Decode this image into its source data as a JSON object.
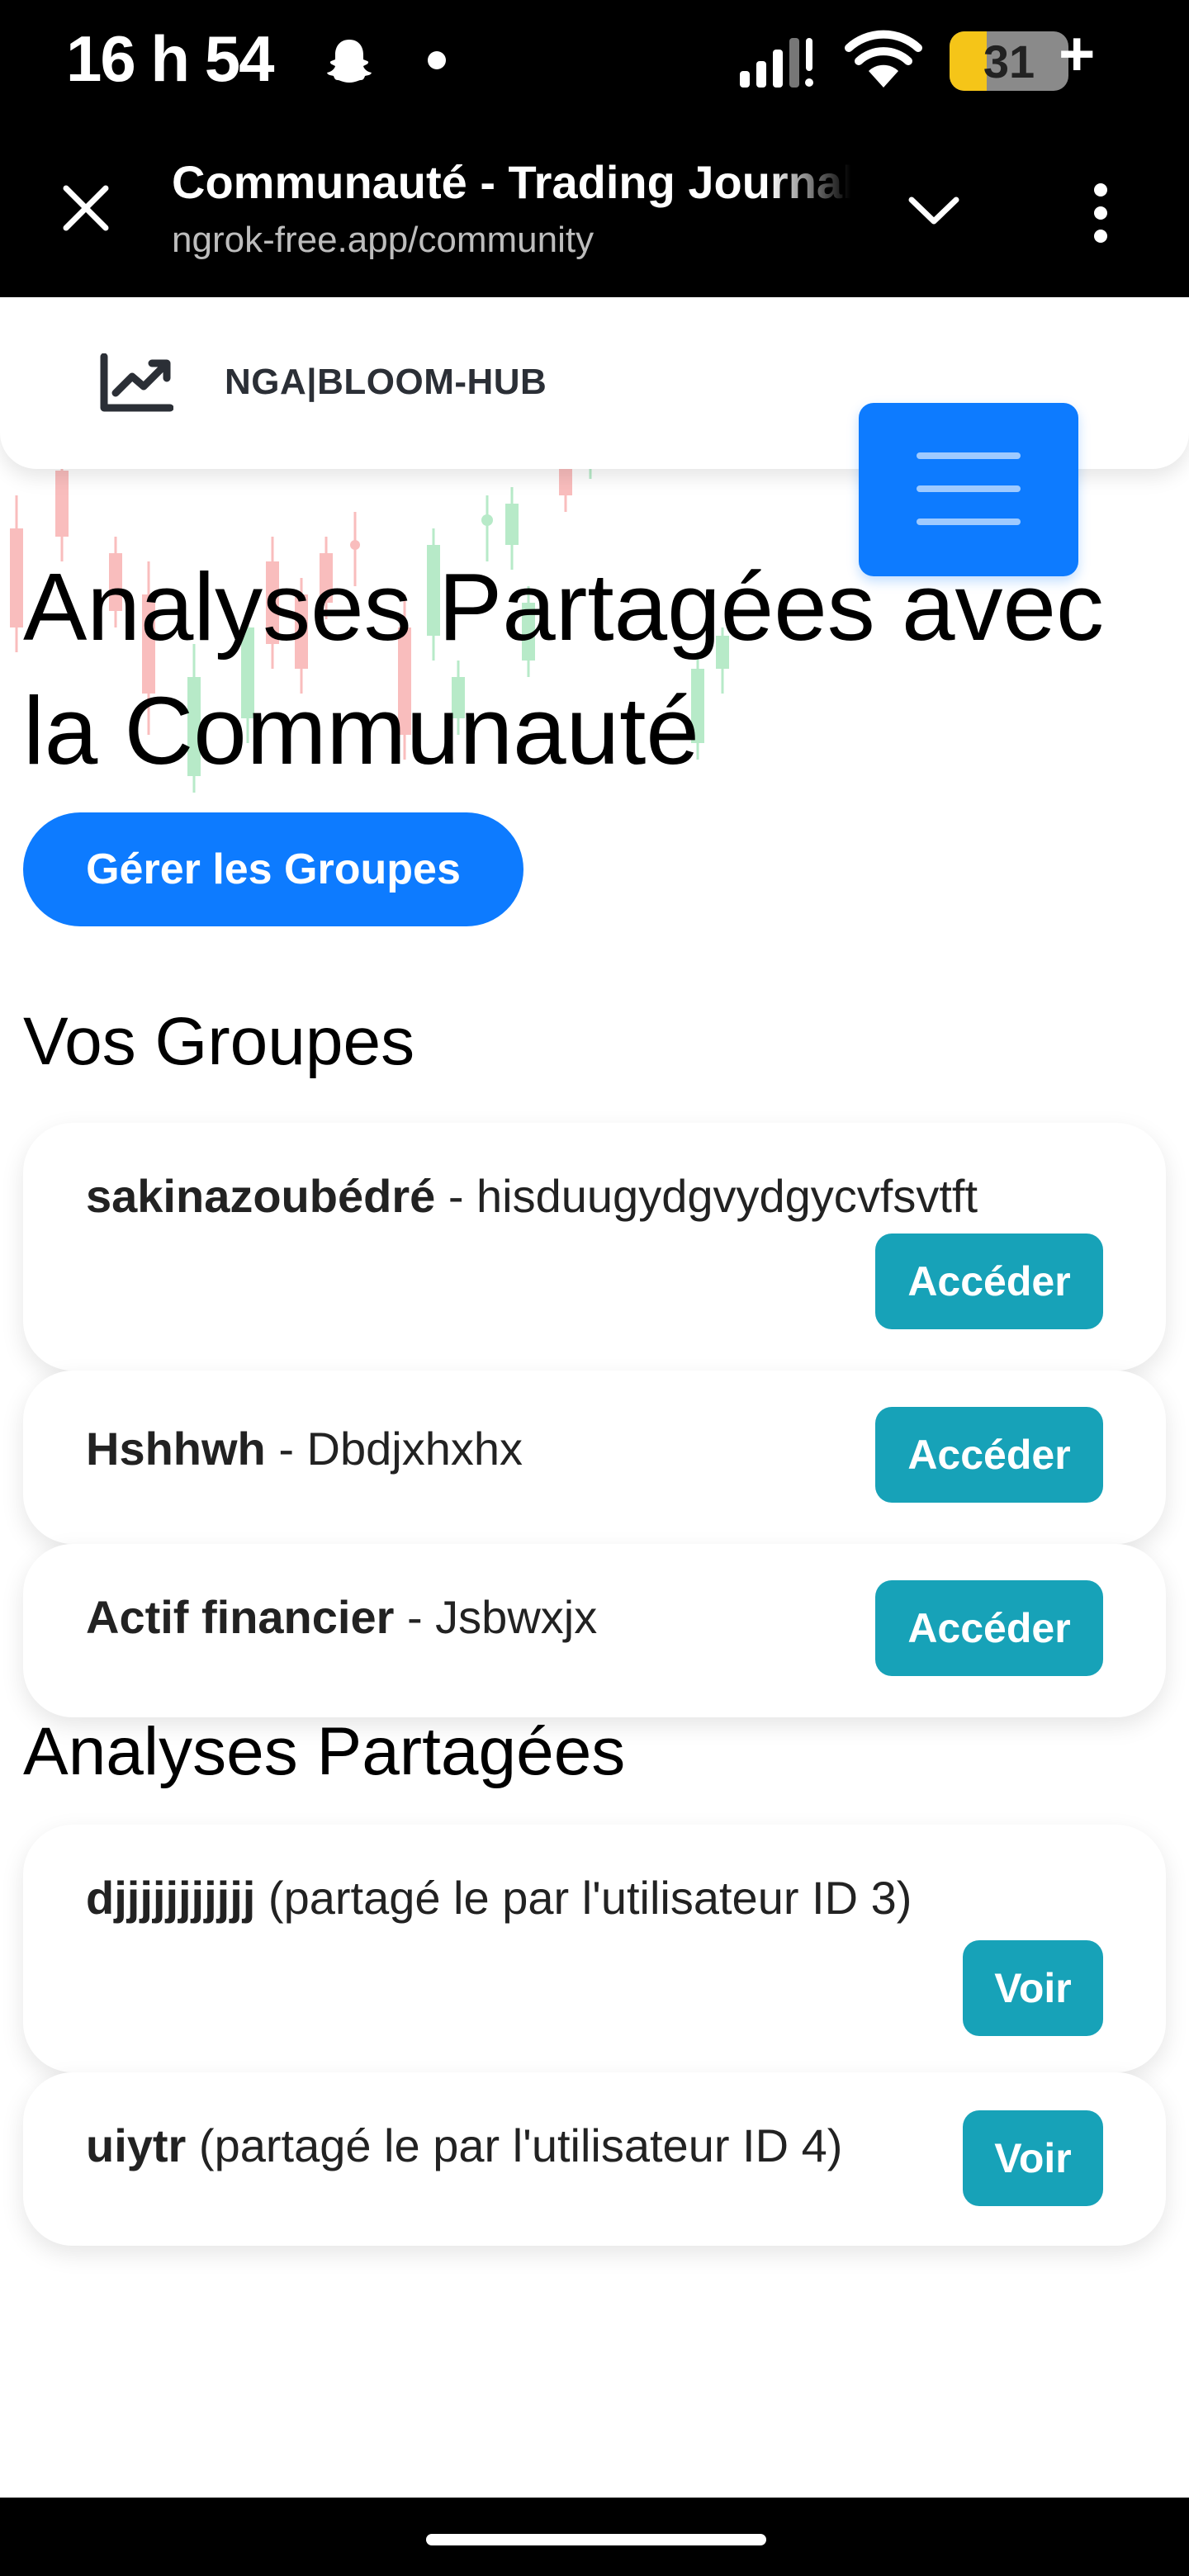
{
  "status_bar": {
    "time": "16 h 54",
    "battery": "31",
    "battery_level": 0.31,
    "plus": "+",
    "icons": [
      "snapchat-ghost-icon",
      "notification-dot-icon",
      "signal-icon",
      "wifi-icon",
      "battery-icon"
    ]
  },
  "browser": {
    "title": "Communauté - Trading Journal",
    "url": "ngrok-free.app/community",
    "icons": [
      "close-icon",
      "chevron-down-icon",
      "more-vertical-icon"
    ]
  },
  "navbar": {
    "brand": "NGA|BLOOM-HUB",
    "icons": [
      "chart-line-icon",
      "hamburger-menu-icon"
    ]
  },
  "page": {
    "title": "Analyses Partagées avec la Communauté",
    "manage_groups_label": "Gérer les Groupes"
  },
  "groups_section": {
    "title": "Vos Groupes",
    "items": [
      {
        "name": "sakinazoubédré",
        "separator": " - ",
        "description": "hisduugydgvydgycvfsvtft",
        "action": "Accéder"
      },
      {
        "name": "Hshhwh",
        "separator": " - ",
        "description": "Dbdjxhxhx",
        "action": "Accéder"
      },
      {
        "name": "Actif financier",
        "separator": " - ",
        "description": "Jsbwxjx",
        "action": "Accéder"
      }
    ]
  },
  "analyses_section": {
    "title": "Analyses Partagées",
    "items": [
      {
        "name": "djjjjjjjjjjj",
        "detail": " (partagé le par l'utilisateur ID 3)",
        "action": "Voir"
      },
      {
        "name": "uiytr",
        "detail": " (partagé le par l'utilisateur ID 4)",
        "action": "Voir"
      }
    ]
  },
  "colors": {
    "primary": "#0d7bff",
    "card_button": "#17a2b8",
    "battery": "#f5c518",
    "candle_up": "#9fe3b6",
    "candle_down": "#f7a8a8"
  }
}
